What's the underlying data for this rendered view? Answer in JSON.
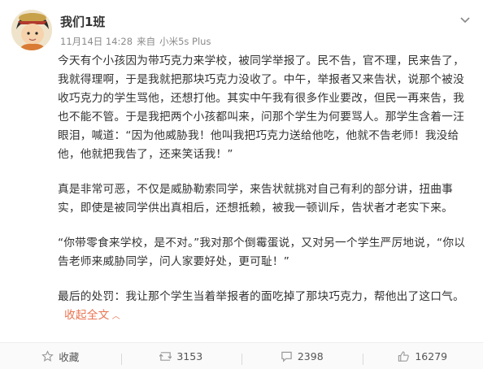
{
  "post": {
    "author": "我们1班",
    "date": "11月14日 14:28",
    "source_prefix": "来自",
    "device": "小米5s Plus",
    "paragraphs": [
      "今天有个小孩因为带巧克力来学校，被同学举报了。民不告，官不理，民来告了，我就得理啊，于是我就把那块巧克力没收了。中午，举报者又来告状，说那个被没收巧克力的学生骂他，还想打他。其实中午我有很多作业要改，但民一再来告，我也不能不管。于是我把两个小孩都叫来，问那个学生为何要骂人。那学生含着一汪眼泪，喊道：“因为他威胁我！他叫我把巧克力送给他吃，他就不告老师！我没给他，他就把我告了，还来笑话我！”",
      "真是非常可恶，不仅是威胁勒索同学，来告状就挑对自己有利的部分讲，扭曲事实，即使是被同学供出真相后，还想抵赖，被我一顿训斥，告状者才老实下来。",
      "“你带零食来学校，是不对。”我对那个倒霉蛋说，又对另一个学生严厉地说，“你以告老师来威胁同学，问人家要好处，更可耻！”",
      "最后的处罚：我让那个学生当着举报者的面吃掉了那块巧克力，帮他出了这口气。"
    ],
    "collapse_label": "收起全文",
    "collapse_icon": "chevron-up-icon"
  },
  "footer": {
    "favorite": {
      "label": "收藏",
      "icon": "star-icon"
    },
    "repost": {
      "count": "3153",
      "icon": "repost-icon"
    },
    "comment": {
      "count": "2398",
      "icon": "comment-icon"
    },
    "like": {
      "count": "16279",
      "icon": "thumbs-up-icon"
    }
  },
  "colors": {
    "text": "#333333",
    "meta": "#8a8a8a",
    "accent": "#eb7350",
    "icon": "#999999"
  }
}
